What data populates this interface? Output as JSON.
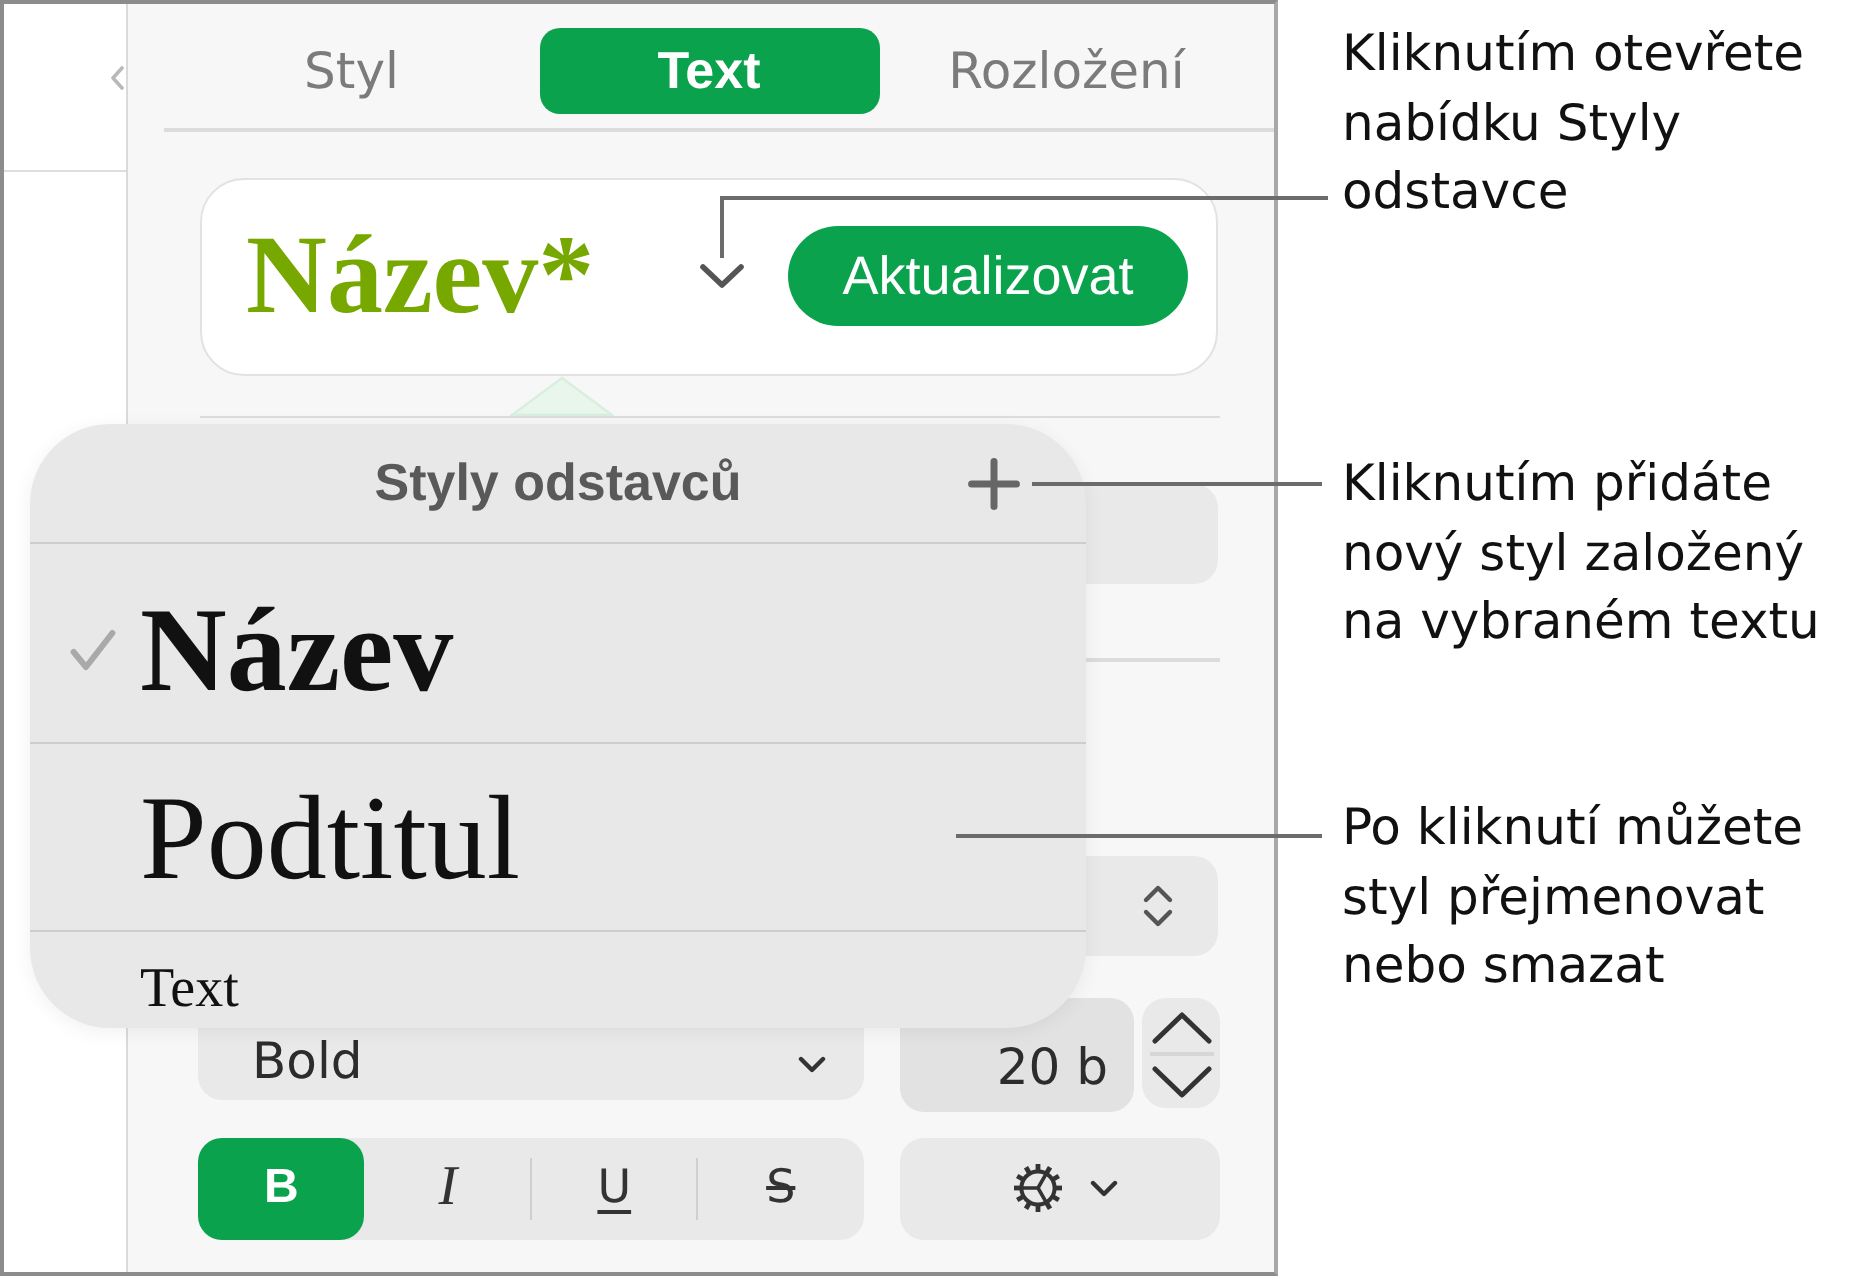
{
  "tabs": [
    {
      "label": "Styl",
      "selected": false
    },
    {
      "label": "Text",
      "selected": true
    },
    {
      "label": "Rozložení",
      "selected": false
    }
  ],
  "style_card": {
    "style_name": "Název*",
    "update_button": "Aktualizovat"
  },
  "paragraph_styles_menu": {
    "title": "Styly odstavců",
    "items": [
      {
        "label": "Název",
        "kind": "title",
        "selected": true
      },
      {
        "label": "Podtitul",
        "kind": "subtitle",
        "selected": false
      },
      {
        "label": "Text",
        "kind": "body",
        "selected": false
      }
    ]
  },
  "font_controls": {
    "typeface": "Bold",
    "size": "20 b"
  },
  "format_buttons": [
    {
      "label": "B",
      "kind": "bold",
      "selected": true
    },
    {
      "label": "I",
      "kind": "italic",
      "selected": false
    },
    {
      "label": "U",
      "kind": "underline",
      "selected": false
    },
    {
      "label": "S",
      "kind": "strikethrough",
      "selected": false
    }
  ],
  "callouts": [
    "Kliknutím otevřete\nnabídku Styly\nodstavce",
    "Kliknutím přidáte\nnový styl založený\nna vybraném textu",
    "Po kliknutí můžete\nstyl přejmenovat\nnebo smazat"
  ]
}
